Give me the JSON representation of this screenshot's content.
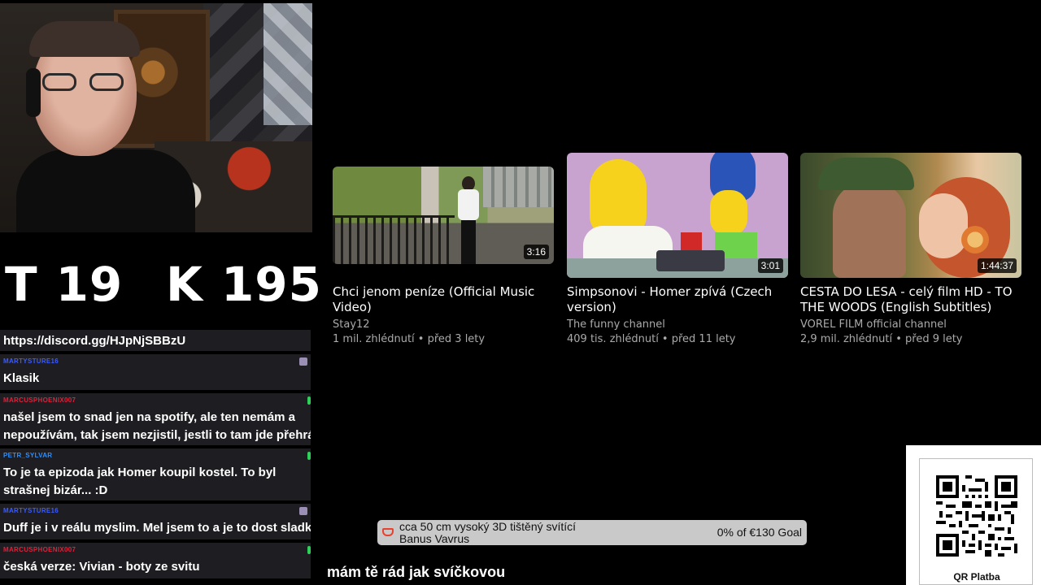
{
  "counters": {
    "t_label": "T",
    "t_value": "19",
    "k_label": "K",
    "k_value": "195"
  },
  "chat": {
    "discord": "https://discord.gg/HJpNjSBBzU",
    "messages": [
      {
        "user": "MARTYSTURE16",
        "user_color": "#3b5bff",
        "text": "Klasik",
        "badge": "grey"
      },
      {
        "user": "MARCUSPHOENIX007",
        "user_color": "#e0203a",
        "text": "našel jsem to snad jen na spotify, ale ten nemám a nepoužívám, tak jsem nezjistil, jestli to tam jde přehrát",
        "badge": "green"
      },
      {
        "user": "PETR_SYLVAR",
        "user_color": "#2b8fff",
        "text": "To je ta epizoda jak Homer koupil kostel. To byl strašnej bizár... :D",
        "badge": "green"
      },
      {
        "user": "MARTYSTURE16",
        "user_color": "#3b5bff",
        "text": "Duff je i v reálu myslim. Mel jsem to a je to dost sladké",
        "badge": "grey"
      },
      {
        "user": "MARCUSPHOENIX007",
        "user_color": "#e0203a",
        "text": "česká verze: Vivian - boty ze svitu",
        "badge": "green"
      }
    ]
  },
  "videos": [
    {
      "title": "Chci jenom peníze (Official Music Video)",
      "channel": "Stay12",
      "meta": "1 mil. zhlédnutí • před 3 lety",
      "duration": "3:16"
    },
    {
      "title": "Simpsonovi - Homer zpívá (Czech version)",
      "channel": "The funny channel",
      "meta": "409 tis. zhlédnutí • před 11 lety",
      "duration": "3:01"
    },
    {
      "title": "CESTA DO LESA - celý film HD - TO THE WOODS (English Subtitles)",
      "channel": "VOREL FILM official channel",
      "meta": "2,9 mil. zhlédnutí • před 9 lety",
      "duration": "1:44:37"
    }
  ],
  "goal": {
    "title_line1": "cca 50 cm vysoký 3D tištěný svítící",
    "title_line2": "Banus Vavrus",
    "amount": "0% of €130 Goal",
    "progress": 0
  },
  "ticker": {
    "text": "mám tě rád jak svíčkovou"
  },
  "qr": {
    "label": "QR Platba"
  },
  "colors": {
    "chat_bg": "#1e1e22",
    "goal_bg": "#c9c9c9",
    "accent_red": "#e7412f"
  }
}
